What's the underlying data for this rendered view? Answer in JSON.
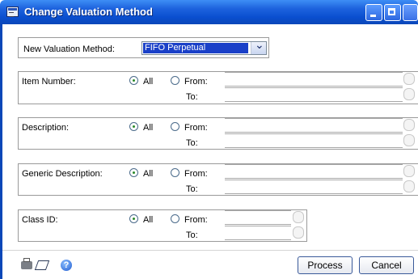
{
  "window": {
    "title": "Change Valuation Method"
  },
  "valuation": {
    "label": "New Valuation Method:",
    "selected": "FIFO Perpetual"
  },
  "sections": [
    {
      "label": "Item Number:",
      "all_label": "All",
      "from_label": "From:",
      "to_label": "To:",
      "selected": "All"
    },
    {
      "label": "Description:",
      "all_label": "All",
      "from_label": "From:",
      "to_label": "To:",
      "selected": "All"
    },
    {
      "label": "Generic Description:",
      "all_label": "All",
      "from_label": "From:",
      "to_label": "To:",
      "selected": "All"
    },
    {
      "label": "Class ID:",
      "all_label": "All",
      "from_label": "From:",
      "to_label": "To:",
      "selected": "All"
    }
  ],
  "buttons": {
    "process": "Process",
    "cancel": "Cancel"
  }
}
